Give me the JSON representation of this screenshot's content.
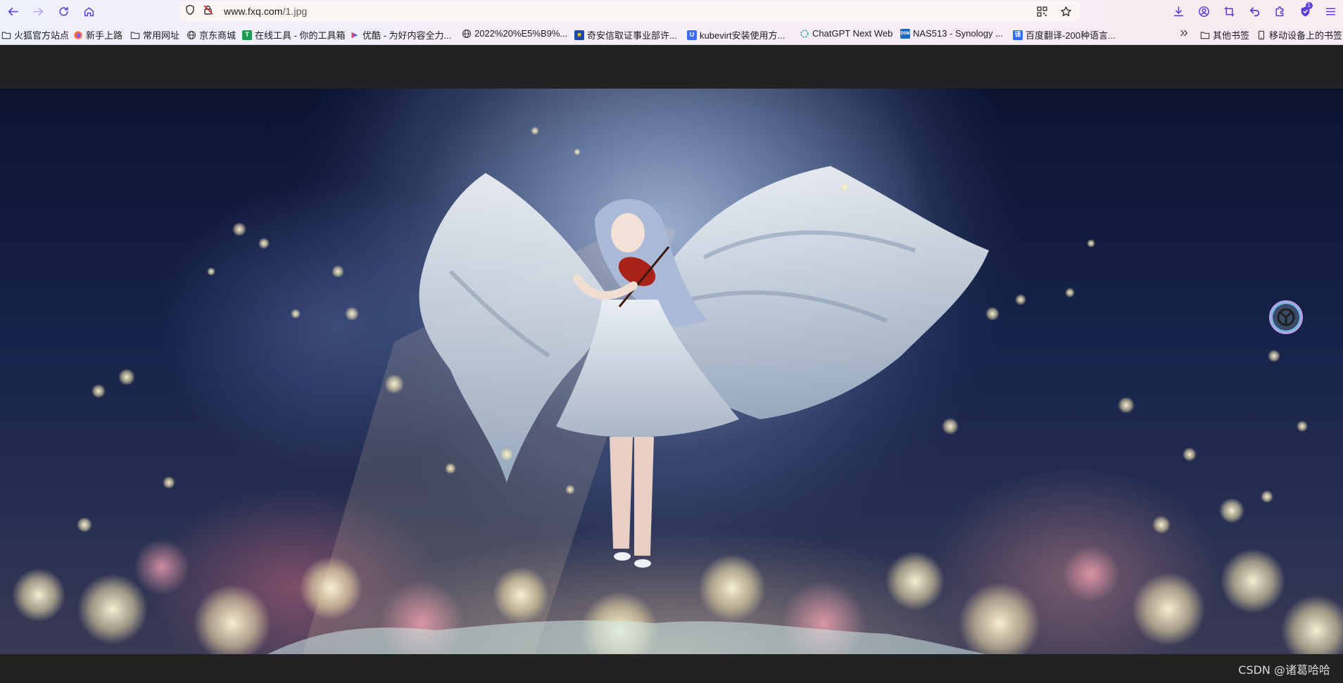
{
  "browser": {
    "url": {
      "host": "www.fxq.com",
      "path": "/1.jpg"
    },
    "extension_badge": "1"
  },
  "bookmarks": [
    {
      "label": "火狐官方站点",
      "icon": "folder-icon"
    },
    {
      "label": "新手上路",
      "icon": "firefox-icon"
    },
    {
      "label": "常用网址",
      "icon": "folder-icon"
    },
    {
      "label": "京东商城",
      "icon": "globe-icon"
    },
    {
      "label": "在线工具 - 你的工具箱",
      "icon": "tool-favicon"
    },
    {
      "label": "优酷 - 为好内容全力...",
      "icon": "youku-favicon"
    },
    {
      "label": "2022%20%E5%B9%...",
      "icon": "globe-icon"
    },
    {
      "label": "奇安信取证事业部许...",
      "icon": "qianxin-favicon"
    },
    {
      "label": "kubevirt安装使用方...",
      "icon": "u-favicon"
    },
    {
      "label": "ChatGPT Next Web",
      "icon": "chatgpt-favicon"
    },
    {
      "label": "NAS513 - Synology ...",
      "icon": "dsm-favicon"
    },
    {
      "label": "百度翻译-200种语言...",
      "icon": "baidu-translate-favicon"
    }
  ],
  "bookmarks_right": [
    {
      "label": "其他书签",
      "icon": "folder-icon"
    },
    {
      "label": "移动设备上的书签",
      "icon": "mobile-icon"
    }
  ],
  "image": {
    "alt": "angel-violinist-wallpaper",
    "colors": {
      "sky": "#0b1330",
      "glow": "#8ea3c6",
      "wing": "#dfe6ee",
      "violin": "#a8221a"
    }
  },
  "watermark": "CSDN @诸葛哈哈"
}
